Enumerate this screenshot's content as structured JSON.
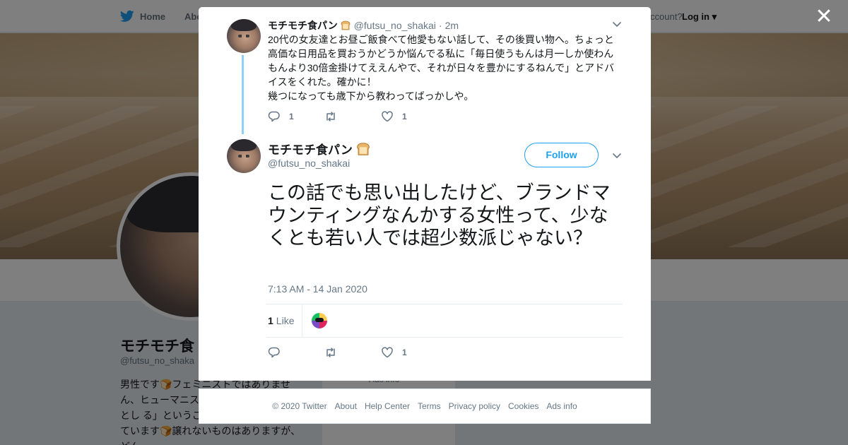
{
  "nav": {
    "home_label": "Home",
    "about_label": "Abo",
    "account_text": "ccount?",
    "login_label": "Log in"
  },
  "profile": {
    "name": "モチモチ食",
    "handle": "@futsu_no_shaka",
    "bio": "男性です🍞フェミニストではありません、ヒューマニストでありしつつ、人間とし る」というごく普通の社会を志向しています🍞譲れないものはありますが、どん",
    "ads_info": "Ads info"
  },
  "tweet1": {
    "name": "モチモチ食パン",
    "handle": "@futsu_no_shakai",
    "separator": "·",
    "time": "2m",
    "text_lines": [
      "20代の女友達とお昼ご飯食べて他愛もない話して、その後買い物へ。ちょっと高価な日用品を買おうかどうか悩んでる私に「毎日使うもんは月一しか使わんもんより30倍金掛けてええんやで、それが日々を豊かにするねんで」とアドバイスをくれた。確かに！",
      "幾つになっても歳下から教わってばっかしや。"
    ],
    "reply_count": "1",
    "retweet_count": "",
    "like_count": "1"
  },
  "tweet2": {
    "name": "モチモチ食パン",
    "handle": "@futsu_no_shakai",
    "follow_label": "Follow",
    "text": "この話でも思い出したけど、ブランドマウンティングなんかする女性って、少なくとも若い人では超少数派じゃない？",
    "timestamp": "7:13 AM - 14 Jan 2020",
    "likes_number": "1",
    "likes_label": "Like",
    "reply_count": "",
    "retweet_count": "",
    "like_count": "1"
  },
  "footer": {
    "copyright": "© 2020 Twitter",
    "links": [
      "About",
      "Help Center",
      "Terms",
      "Privacy policy",
      "Cookies",
      "Ads info"
    ]
  },
  "colors": {
    "twitter_blue": "#1da1f2",
    "thread_line": "#8ed0f9",
    "muted_text": "#657786"
  },
  "icons": {
    "close": "close-icon",
    "twitter": "twitter-bird-icon",
    "bread": "bread-emoji-icon",
    "reply": "reply-icon",
    "retweet": "retweet-icon",
    "like": "heart-icon",
    "chevron": "chevron-down-icon"
  }
}
